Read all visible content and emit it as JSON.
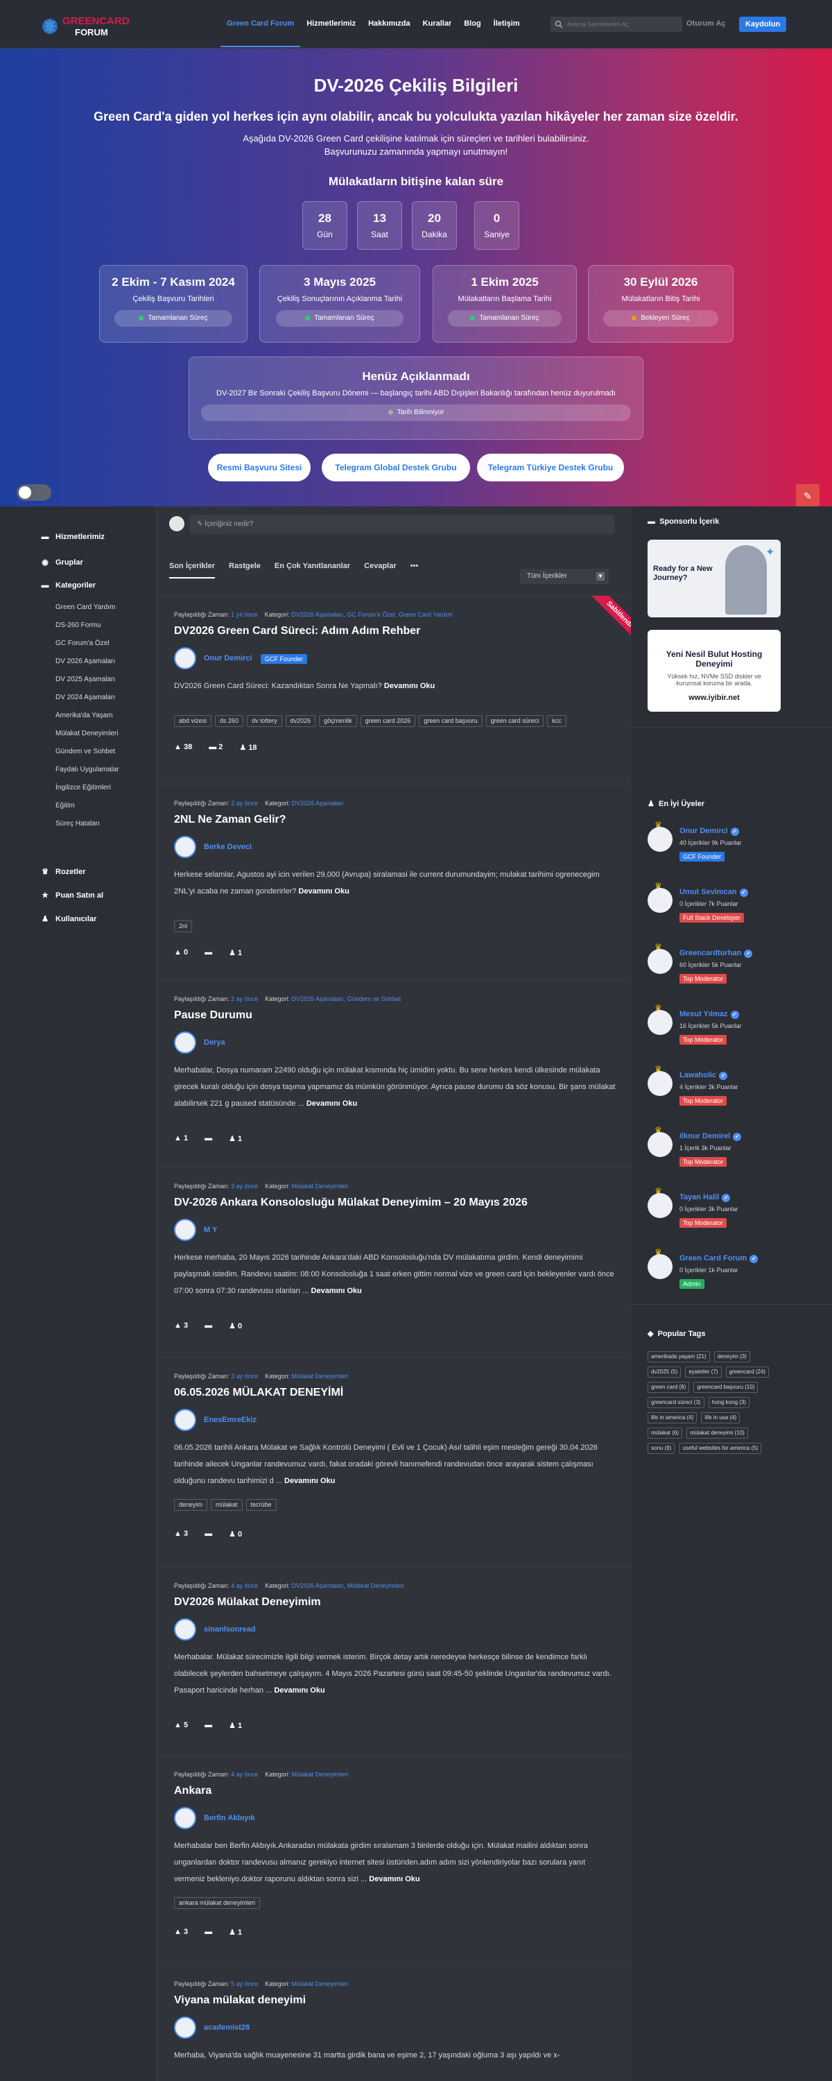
{
  "header": {
    "logo_text_top": "GREENCARD",
    "logo_text_bottom": "FORUM",
    "nav": [
      "Green Card Forum",
      "Hizmetlerimiz",
      "Hakkımızda",
      "Kurallar",
      "Blog",
      "İletişim"
    ],
    "search_placeholder": "Arama Sekmelerini Aç",
    "login": "Oturum Aç",
    "register": "Kaydolun"
  },
  "hero": {
    "title": "DV-2026 Çekiliş Bilgileri",
    "subtitle": "Green Card'a giden yol herkes için aynı olabilir, ancak bu yolculukta yazılan hikâyeler her zaman size özeldir.",
    "description": "Aşağıda DV-2026 Green Card çekilişine katılmak için süreçleri ve tarihleri bulabilirsiniz. Başvurunuzu zamanında yapmayı unutmayın!",
    "countdown_title": "Mülakatların bitişine kalan süre",
    "countdown": [
      {
        "value": "28",
        "label": "Gün"
      },
      {
        "value": "13",
        "label": "Saat"
      },
      {
        "value": "20",
        "label": "Dakika"
      },
      {
        "value": "0",
        "label": "Saniye"
      }
    ],
    "dates": [
      {
        "date": "2 Ekim - 7 Kasım 2024",
        "text": "Çekiliş Başvuru Tarihleri",
        "status": "Tamamlanan Süreç",
        "status_color": "#2ecc71"
      },
      {
        "date": "3 Mayıs 2025",
        "text": "Çekiliş Sonuçlarının Açıklanma Tarihi",
        "status": "Tamamlanan Süreç",
        "status_color": "#2ecc71"
      },
      {
        "date": "1 Ekim 2025",
        "text": "Mülakatların Başlama Tarihi",
        "status": "Tamamlanan Süreç",
        "status_color": "#2ecc71"
      },
      {
        "date": "30 Eylül 2026",
        "text": "Mülakatların Bitiş Tarihi",
        "status": "Bekleyen Süreç",
        "status_color": "#f39c12"
      }
    ],
    "announcement_title": "Henüz Açıklanmadı",
    "announcement_text": "DV-2027 Bir Sonraki Çekiliş Başvuru Dönemi — başlangıç tarihi ABD Dışişleri Bakanlığı tarafından henüz duyurulmadı",
    "announcement_status": "Tarih Bilinmiyor",
    "buttons": [
      "Resmi Başvuru Sitesi",
      "Telegram Global Destek Grubu",
      "Telegram Türkiye Destek Grubu"
    ]
  },
  "left_menu": {
    "main": [
      "Hizmetlerimiz",
      "Gruplar",
      "Kategoriler"
    ],
    "categories": [
      "Green Card Yardım",
      "DS-260 Formu",
      "GC Forum'a Özel",
      "DV 2026 Aşamaları",
      "DV 2025 Aşamaları",
      "DV 2024 Aşamaları",
      "Amerika'da Yaşam",
      "Mülakat Deneyimleri",
      "Gündem ve Sohbet",
      "Faydalı Uygulamalar",
      "İngilizce Eğitimleri",
      "Eğitim",
      "Süreç Hataları"
    ],
    "bottom": [
      "Rozetler",
      "Puan Satın al",
      "Kullanıcılar"
    ]
  },
  "feed": {
    "compose_placeholder": "İçeriğiniz nedir?",
    "tabs": [
      "Son İçerikler",
      "Rastgele",
      "En Çok Yanıtlananlar",
      "Cevaplar",
      "•••"
    ],
    "filter": "Tüm İçerikler",
    "shared_label": "Paylaşıldığı Zaman:",
    "category_label": "Kategori:",
    "pinned": "Sabitlendi",
    "read_more": "Devamını Oku",
    "posts": [
      {
        "time": "1 yıl önce",
        "category": "DV2026 Aşamaları, GC Forum'a Özel, Green Card Yardım",
        "title": "DV2026 Green Card Süreci: Adım Adım Rehber",
        "author": "Onur Demirci",
        "badge": "GCF Founder",
        "body": "DV2026 Green Card Süreci: Kazandıktan Sonra Ne Yapmalı?",
        "tags": [
          "abd vizesi",
          "ds 260",
          "dv lottery",
          "dv2026",
          "göçmenlik",
          "green card 2026",
          "green card başvuru",
          "green card süreci",
          "kcc"
        ],
        "votes": "38",
        "comments": "2",
        "views": "18"
      },
      {
        "time": "2 ay önce",
        "category": "DV2026 Aşamaları",
        "title": "2NL Ne Zaman Gelir?",
        "author": "Berke Deveci",
        "badge": "",
        "body": "Herkese selamlar, Agustos ayi icin verilen 29,000 (Avrupa) siralamasi ile current durumundayim; mulakat tarihimi ogrenecegim 2NL'yi acaba ne zaman gonderirler?",
        "tags": [
          "2nl"
        ],
        "votes": "0",
        "comments": "",
        "views": "1"
      },
      {
        "time": "2 ay önce",
        "category": "DV2026 Aşamaları, Gündem ve Sohbet",
        "title": "Pause Durumu",
        "author": "Derya",
        "badge": "",
        "body": "Merhabalar, Dosya numaram 22490 olduğu için mülakat kısmında hiç ümidim yoktu. Bu sene herkes kendi ülkesinde mülakata girecek kuralı olduğu için dosya taşıma yapmamız da mümkün görünmüyor. Ayrıca pause durumu da söz konusu. Bir şans mülakat alabilirsek 221 g paused statüsünde ...",
        "tags": [],
        "votes": "1",
        "comments": "",
        "views": "1"
      },
      {
        "time": "3 ay önce",
        "category": "Mülakat Deneyimleri",
        "title": "DV-2026 Ankara Konsolosluğu Mülakat Deneyimim – 20 Mayıs 2026",
        "author": "M Y",
        "badge": "",
        "body": "Herkese merhaba, 20 Mayıs 2026 tarihinde Ankara'daki ABD Konsolosluğu'nda DV mülakatıma girdim. Kendi deneyimimi paylaşmak istedim. Randevu saatim: 08:00 Konsolosluğa 1 saat erken gittim normal vize ve green card için bekleyenler vardı önce 07:00 sonra 07:30 randevusu olanları ...",
        "tags": [],
        "votes": "3",
        "comments": "",
        "views": "0"
      },
      {
        "time": "3 ay önce",
        "category": "Mülakat Deneyimleri",
        "title": "06.05.2026 MÜLAKAT DENEYİMİ",
        "author": "EnesEmreEkiz",
        "badge": "",
        "body": "06.05.2026 tarihli Ankara Mülakat ve Sağlık Kontrolü Deneyimi ( Evli ve 1 Çocuk) Asıl talihli eşim   mesleğim gereği 30.04.2026 tarihinde ailecek Unganlar randevumuz vardı, fakat oradaki görevli hanımefendi randevudan önce arayarak sistem çalışması olduğunu randevu tarihimizi d ...",
        "tags": [
          "deneyim",
          "mülakat",
          "tecrübe"
        ],
        "votes": "3",
        "comments": "",
        "views": "0"
      },
      {
        "time": "4 ay önce",
        "category": "DV2026 Aşamaları, Mülakat Deneyimleri",
        "title": "DV2026 Mülakat Deneyimim",
        "author": "sinanlsonread",
        "badge": "",
        "body": "Merhabalar. Mülakat sürecimizle ilgili bilgi vermek isterim. Birçok detay artık neredeyse herkesçe bilinse de kendimce farklı olabilecek şeylerden bahsetmeye çalışayım. 4 Mayıs 2026 Pazartesi günü saat 09:45-50 şeklinde Unganlar'da randevumuz vardı. Pasaport haricinde herhan ...",
        "tags": [],
        "votes": "5",
        "comments": "",
        "views": "1"
      },
      {
        "time": "4 ay önce",
        "category": "Mülakat Deneyimleri",
        "title": "Ankara",
        "author": "Berfin Akbıyık",
        "badge": "",
        "body": "Merhabalar ben Berfin Akbıyık.Ankaradan mülakata girdim sıralamam 3 binlerde olduğu için. Mülakat mailini aldıktan sonra unganlardan doktor randevusu almanız gerekiyo internet sitesi üstünden.adım adım sizi yönlendiriyolar bazı sorulara yanıt vermeniz bekleniyo.doktor raporunu aldıktan sonra sizi ...",
        "tags": [
          "ankara mülakat deneyimleri"
        ],
        "votes": "3",
        "comments": "",
        "views": "1"
      },
      {
        "time": "5 ay önce",
        "category": "Mülakat Deneyimleri",
        "title": "Viyana mülakat deneyimi",
        "author": "academist28",
        "badge": "",
        "body": "Merhaba, Viyana'da sağlık muayenesine 31 martta girdik bana ve eşime 2, 17 yaşındaki oğluma 3 aşı yapıldı ve x-",
        "tags": [],
        "votes": "",
        "comments": "",
        "views": ""
      }
    ]
  },
  "right": {
    "sponsored_title": "Sponsorlu İçerik",
    "ad1_text": "Ready for a New Journey?",
    "ad2_title": "Yeni Nesil Bulut Hosting Deneyimi",
    "ad2_text": "Yüksek hız, NVMe SSD diskler ve kurumsal koruma bir arada.",
    "ad2_url": "www.iyibir.net",
    "top_users_title": "En İyi Üyeler",
    "users": [
      {
        "name": "Onur Demirci",
        "stats": "40 İçerikler   9k Puanlar",
        "role": "GCF Founder",
        "role_color": "#2b79e9"
      },
      {
        "name": "Umut Sevimcan",
        "stats": "0 İçerikler   7k Puanlar",
        "role": "Full Stack Developer",
        "role_color": "#e04a4a"
      },
      {
        "name": "Greencardturhan",
        "stats": "60 İçerikler   5k Puanlar",
        "role": "Top Moderator",
        "role_color": "#e04a4a"
      },
      {
        "name": "Mesut Yılmaz",
        "stats": "16 İçerikler   5k Puanlar",
        "role": "Top Moderator",
        "role_color": "#e04a4a"
      },
      {
        "name": "Lawaholic",
        "stats": "4 İçerikler   3k Puanlar",
        "role": "Top Moderator",
        "role_color": "#e04a4a"
      },
      {
        "name": "ilknur Demirel",
        "stats": "1 İçerik   3k Puanlar",
        "role": "Top Moderator",
        "role_color": "#e04a4a"
      },
      {
        "name": "Tayan Halil",
        "stats": "0 İçerikler   3k Puanlar",
        "role": "Top Moderator",
        "role_color": "#e04a4a"
      },
      {
        "name": "Green Card Forum",
        "stats": "0 İçerikler   1k Puanlar",
        "role": "Admin",
        "role_color": "#27ae60"
      }
    ],
    "popular_tags_title": "Popular Tags",
    "tags": [
      "amerikada yaşam (21)",
      "deneyim (3)",
      "dv2025 (5)",
      "eyaletler (7)",
      "greencard (24)",
      "green card (8)",
      "greencard başvuru (10)",
      "greencard süreci (3)",
      "hong kong (3)",
      "life in america (4)",
      "life in usa (4)",
      "mülakat (6)",
      "mülakat deneyimi (10)",
      "sonu (9)",
      "useful websites for america (5)"
    ]
  }
}
